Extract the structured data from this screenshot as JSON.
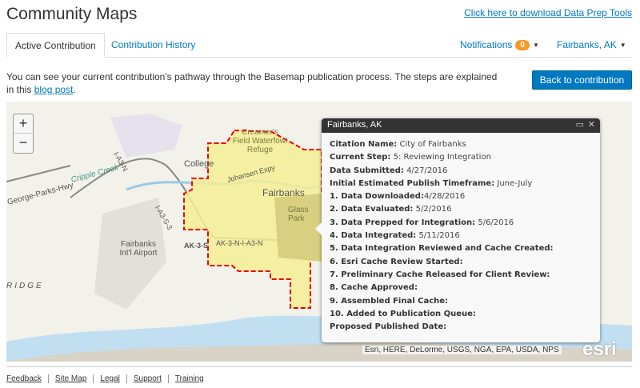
{
  "header": {
    "title": "Community Maps",
    "download_link": "Click here to download Data Prep Tools"
  },
  "tabs": [
    {
      "label": "Active Contribution"
    },
    {
      "label": "Contribution History"
    }
  ],
  "notifications": {
    "label": "Notifications",
    "count": "0"
  },
  "account": {
    "label": "Fairbanks, AK"
  },
  "intro": {
    "text": "You can see your current contribution's pathway through the Basemap publication process. The steps are explained in this ",
    "link": "blog post",
    "end": "."
  },
  "back_button": "Back to contribution",
  "map": {
    "zoom_in": "+",
    "zoom_out": "−",
    "labels": {
      "creamers": "Creamer's Field Waterfowl Refuge",
      "college": "College",
      "fairbanks": "Fairbanks",
      "glass_park": "Glass Park",
      "airport": "Fairbanks Int'l Airport",
      "parks_hwy": "George-Parks-Hwy",
      "cripple": "Cripple Creek",
      "johansen": "Johansen Expy",
      "a3n": "I-A3-N",
      "a3s": "I-A3-S-3",
      "ak3s": "AK-3-S",
      "ak3n": "AK-3-N-I-A3-N",
      "ridge": "RIDGE"
    },
    "attribution": "Esri, HERE, DeLorme, USGS, NGA, EPA, USDA, NPS",
    "logo": "esri"
  },
  "popup": {
    "title": "Fairbanks, AK",
    "rows": [
      {
        "label": "Citation Name:",
        "value": " City of Fairbanks"
      },
      {
        "label": "Current Step:",
        "value": " 5: Reviewing Integration"
      },
      {
        "label": "Data Submitted:",
        "value": " 4/27/2016"
      },
      {
        "label": "Initial Estimated Publish Timeframe:",
        "value": " June-July"
      },
      {
        "label": "1. Data Downloaded:",
        "value": "4/28/2016"
      },
      {
        "label": "2. Data Evaluated:",
        "value": " 5/2/2016"
      },
      {
        "label": "3. Data Prepped for Integration:",
        "value": " 5/6/2016"
      },
      {
        "label": "4. Data Integrated:",
        "value": " 5/11/2016"
      },
      {
        "label": "5. Data Integration Reviewed and Cache Created:",
        "value": ""
      },
      {
        "label": "6. Esri Cache Review Started:",
        "value": ""
      },
      {
        "label": "7. Preliminary Cache Released for Client Review:",
        "value": ""
      },
      {
        "label": "8. Cache Approved:",
        "value": ""
      },
      {
        "label": "9. Assembled Final Cache:",
        "value": ""
      },
      {
        "label": "10. Added to Publication Queue:",
        "value": ""
      },
      {
        "label": "Proposed Published Date:",
        "value": ""
      }
    ]
  },
  "footer": [
    "Feedback",
    "Site Map",
    "Legal",
    "Support",
    "Training"
  ]
}
